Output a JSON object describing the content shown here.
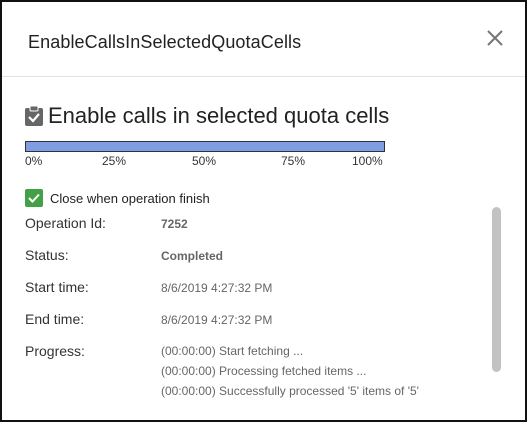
{
  "dialog": {
    "title": "EnableCallsInSelectedQuotaCells",
    "close_icon": "close-icon"
  },
  "operation": {
    "title": "Enable calls in selected quota cells",
    "title_icon": "clipboard-check-icon",
    "progress_fraction": 1.0,
    "progress_color": "#7f9de2",
    "scale_labels": [
      "0%",
      "25%",
      "50%",
      "75%",
      "100%"
    ],
    "close_when_finish": {
      "checked": true,
      "label": "Close when operation finish",
      "color": "#43a047"
    },
    "fields": {
      "operation_id": {
        "label": "Operation Id:",
        "value": "7252"
      },
      "status": {
        "label": "Status:",
        "value": "Completed"
      },
      "start_time": {
        "label": "Start time:",
        "value": "8/6/2019 4:27:32 PM"
      },
      "end_time": {
        "label": "End time:",
        "value": "8/6/2019 4:27:32 PM"
      },
      "progress": {
        "label": "Progress:",
        "lines": [
          "(00:00:00) Start fetching ...",
          "(00:00:00) Processing fetched items ...",
          "(00:00:00) Successfully processed '5' items of '5'"
        ]
      }
    }
  }
}
